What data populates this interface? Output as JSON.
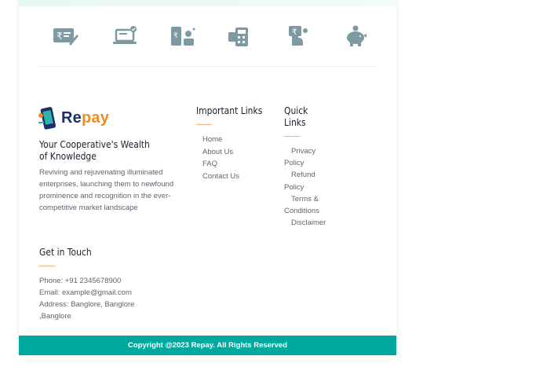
{
  "colors": {
    "accent": "#00a99d",
    "icon": "#7d9aa3",
    "heading": "#1d1f2e",
    "body_text": "#5f6470",
    "underline": "#f0b27a",
    "logo_re": "#1f2d6b",
    "logo_pay": "#f28c1e"
  },
  "service_icons": [
    "rupee-cheque-icon",
    "laptop-check-icon",
    "mobile-cash-icon",
    "calculator-card-icon",
    "hand-money-icon",
    "piggy-bank-icon"
  ],
  "brand": {
    "name_part1": "Re",
    "name_part2": "pay",
    "tagline": "Your Cooperative's Wealth of Knowledge",
    "about": "Reviving and rejuvenating illuminated enterprises, launching them to newfound prominence and recognition in the ever-competitive market landscape"
  },
  "get_in_touch": {
    "heading": "Get in Touch",
    "phone": "Phone: +91 2345678900",
    "email": "Email: example@gmail.com",
    "address": "Address: Banglore, Banglore ,Banglore"
  },
  "important_links": {
    "heading": "Important Links",
    "items": [
      "Home",
      "About Us",
      "FAQ",
      "Contact Us"
    ]
  },
  "quick_links": {
    "heading": "Quick Links",
    "items": [
      "Privacy Policy",
      "Refund Policy",
      "Terms & Conditions",
      "Disclaimer"
    ]
  },
  "footer": {
    "copyright": "Copyright @2023 Repay. All Rights Reserved"
  }
}
